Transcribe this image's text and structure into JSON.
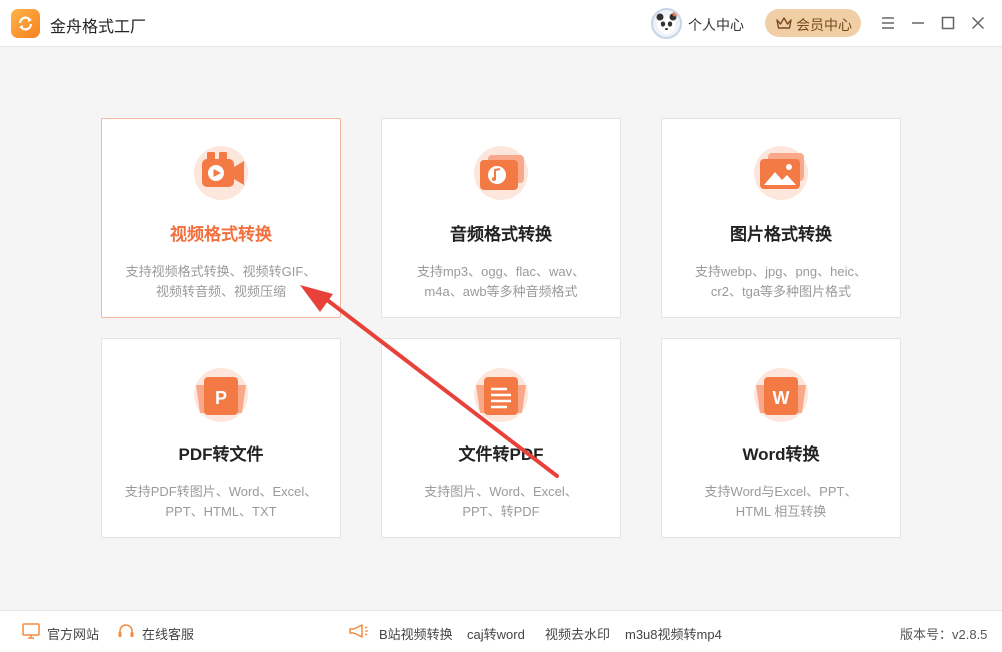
{
  "app": {
    "title": "金舟格式工厂"
  },
  "header": {
    "user_center": "个人中心",
    "vip_center": "会员中心"
  },
  "cards": [
    {
      "title": "视频格式转换",
      "desc1": "支持视频格式转换、视频转GIF、",
      "desc2": "视频转音频、视频压缩"
    },
    {
      "title": "音频格式转换",
      "desc1": "支持mp3、ogg、flac、wav、",
      "desc2": "m4a、awb等多种音频格式"
    },
    {
      "title": "图片格式转换",
      "desc1": "支持webp、jpg、png、heic、",
      "desc2": "cr2、tga等多种图片格式"
    },
    {
      "title": "PDF转文件",
      "desc1": "支持PDF转图片、Word、Excel、",
      "desc2": "PPT、HTML、TXT"
    },
    {
      "title": "文件转PDF",
      "desc1": "支持图片、Word、Excel、",
      "desc2": "PPT、转PDF"
    },
    {
      "title": "Word转换",
      "desc1": "支持Word与Excel、PPT、",
      "desc2": "HTML 相互转换"
    }
  ],
  "footer": {
    "website": "官方网站",
    "service": "在线客服",
    "links": [
      "B站视频转换",
      "caj转word",
      "视频去水印",
      "m3u8视频转mp4"
    ],
    "version": "版本号：v2.8.5"
  },
  "colors": {
    "accent": "#f26f3e",
    "vip": "#f0cfa7",
    "arrow": "#e8413a"
  }
}
